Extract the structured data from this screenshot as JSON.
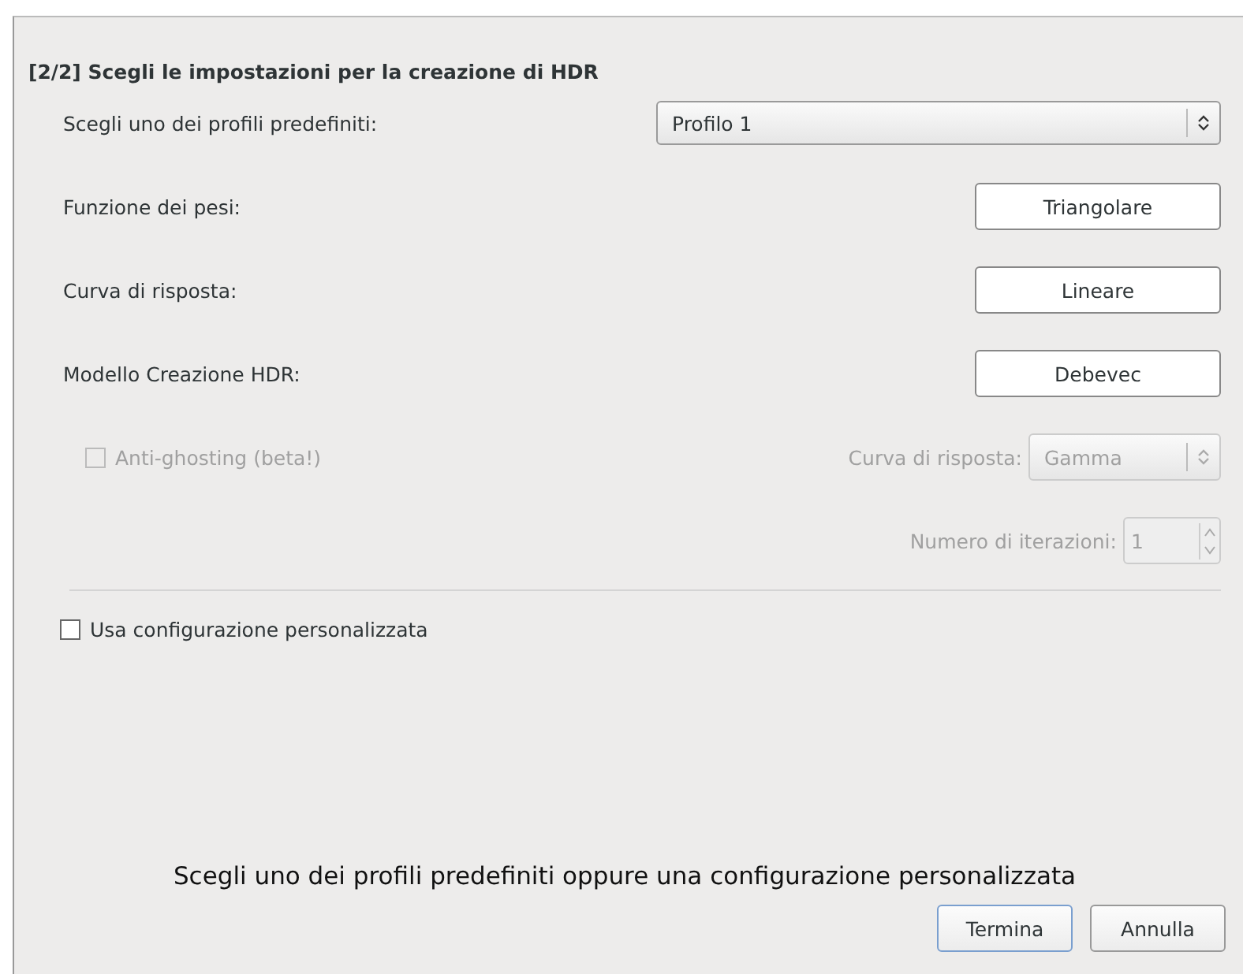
{
  "heading": "[2/2] Scegli le impostazioni per la creazione di HDR",
  "profile": {
    "label": "Scegli uno dei profili predefiniti:",
    "value": "Profilo 1"
  },
  "settings": [
    {
      "label": "Funzione dei pesi:",
      "value": "Triangolare"
    },
    {
      "label": "Curva di risposta:",
      "value": "Lineare"
    },
    {
      "label": "Modello Creazione HDR:",
      "value": "Debevec"
    }
  ],
  "anti_ghosting": {
    "label": "Anti-ghosting (beta!)",
    "checked": false,
    "disabled": true,
    "curve_label": "Curva di risposta:",
    "curve_value": "Gamma",
    "iterations_label": "Numero di iterazioni:",
    "iterations_value": "1"
  },
  "custom_config": {
    "label": "Usa configurazione personalizzata",
    "checked": false
  },
  "message": "Scegli uno dei profili predefiniti oppure una configurazione personalizzata",
  "buttons": [
    {
      "label": "Termina",
      "default": true
    },
    {
      "label": "Annulla",
      "default": false
    }
  ]
}
